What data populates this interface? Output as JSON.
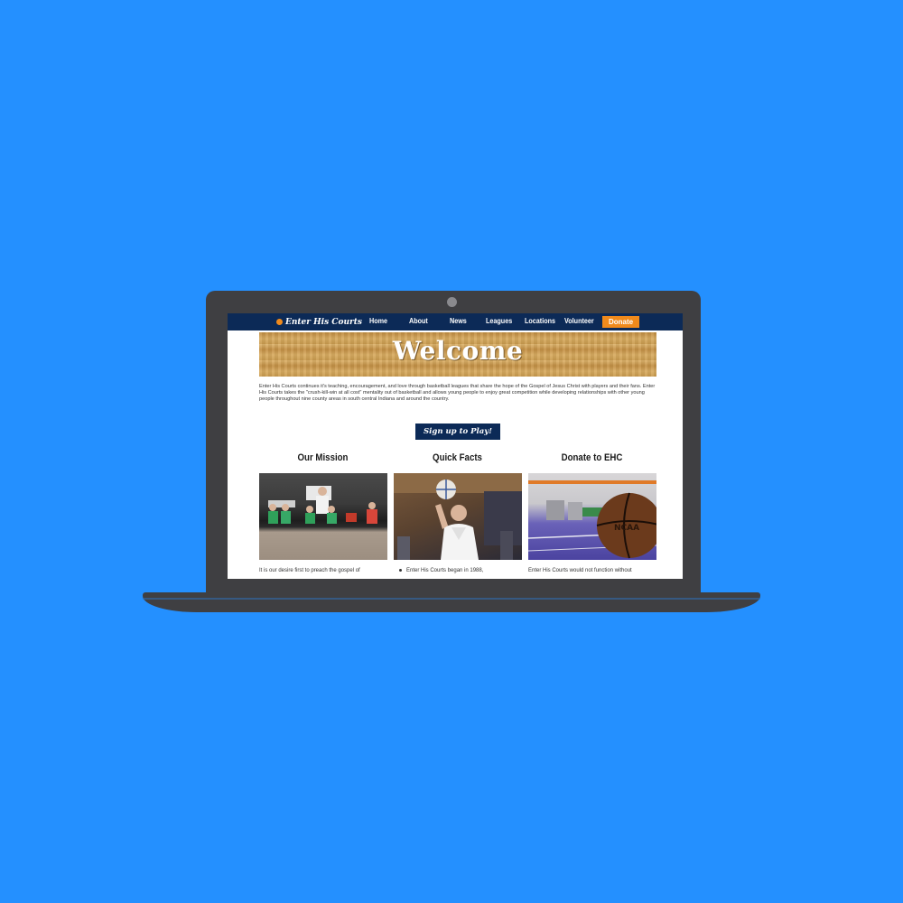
{
  "nav": {
    "logo": "Enter His Courts",
    "items": [
      "Home",
      "About",
      "News",
      "Leagues",
      "Locations",
      "Volunteer"
    ],
    "donate": "Donate"
  },
  "banner": {
    "title": "Welcome"
  },
  "intro": "Enter His Courts continues it's teaching, encouragement, and love through basketball leagues that share the hope of the Gospel of Jesus Christ with players and their fans. Enter His Courts takes the \"crush-kill-win at all cost\" mentality out of basketball and allows young people to enjoy great competition while developing relationships with other young people throughout nine county areas in south central Indiana and around the country.",
  "cta": "Sign up to Play!",
  "columns": [
    {
      "title": "Our Mission",
      "text": "It is our desire first to preach the gospel of"
    },
    {
      "title": "Quick Facts",
      "text": "Enter His Courts began in 1988,"
    },
    {
      "title": "Donate to EHC",
      "text": "Enter His Courts would not function without"
    }
  ],
  "colors": {
    "background": "#2490FF",
    "nav": "#0c2a57",
    "accent": "#f08a1c"
  }
}
